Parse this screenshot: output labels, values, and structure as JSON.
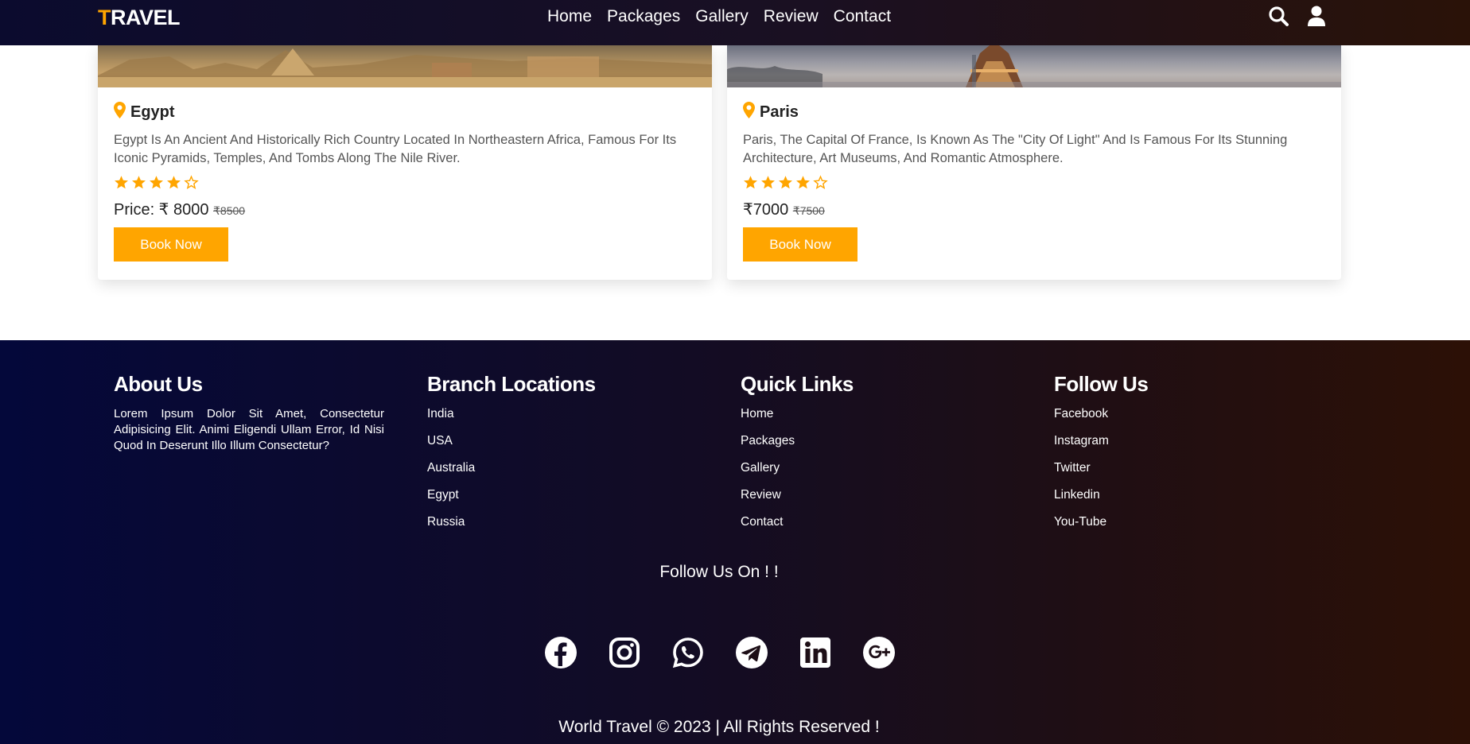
{
  "header": {
    "logo_first": "T",
    "logo_rest": "RAVEL",
    "nav": [
      "Home",
      "Packages",
      "Gallery",
      "Review",
      "Contact"
    ],
    "icons": [
      "search-icon",
      "user-icon"
    ]
  },
  "cards": [
    {
      "name": "Egypt",
      "description": "Egypt Is An Ancient And Historically Rich Country Located In Northeastern Africa, Famous For Its Iconic Pyramids, Temples, And Tombs Along The Nile River.",
      "rating": 4,
      "max_rating": 5,
      "price": "Price: ₹ 8000",
      "old_price": "₹8500",
      "button": "Book Now"
    },
    {
      "name": "Paris",
      "description": "Paris, The Capital Of France, Is Known As The \"City Of Light\" And Is Famous For Its Stunning Architecture, Art Museums, And Romantic Atmosphere.",
      "rating": 4,
      "max_rating": 5,
      "price": "₹7000",
      "old_price": "₹7500",
      "button": "Book Now"
    }
  ],
  "footer": {
    "about": {
      "title": "About Us",
      "text": "Lorem Ipsum Dolor Sit Amet, Consectetur Adipisicing Elit. Animi Eligendi Ullam Error, Id Nisi Quod In Deserunt Illo Illum Consectetur?"
    },
    "branches": {
      "title": "Branch Locations",
      "items": [
        "India",
        "USA",
        "Australia",
        "Egypt",
        "Russia"
      ]
    },
    "quick_links": {
      "title": "Quick Links",
      "items": [
        "Home",
        "Packages",
        "Gallery",
        "Review",
        "Contact"
      ]
    },
    "follow": {
      "title": "Follow Us",
      "items": [
        "Facebook",
        "Instagram",
        "Twitter",
        "Linkedin",
        "You-Tube"
      ]
    },
    "follow_on": "Follow Us On ! !",
    "social_icons": [
      "facebook-icon",
      "instagram-icon",
      "whatsapp-icon",
      "telegram-icon",
      "linkedin-icon",
      "google-plus-icon"
    ],
    "copyright": "World Travel © 2023 | All Rights Reserved !"
  },
  "colors": {
    "accent": "#ffa500",
    "header_start": "#0b0b2e",
    "header_end": "#2a1208",
    "footer_start": "#04083a",
    "footer_end": "#2c1006"
  }
}
